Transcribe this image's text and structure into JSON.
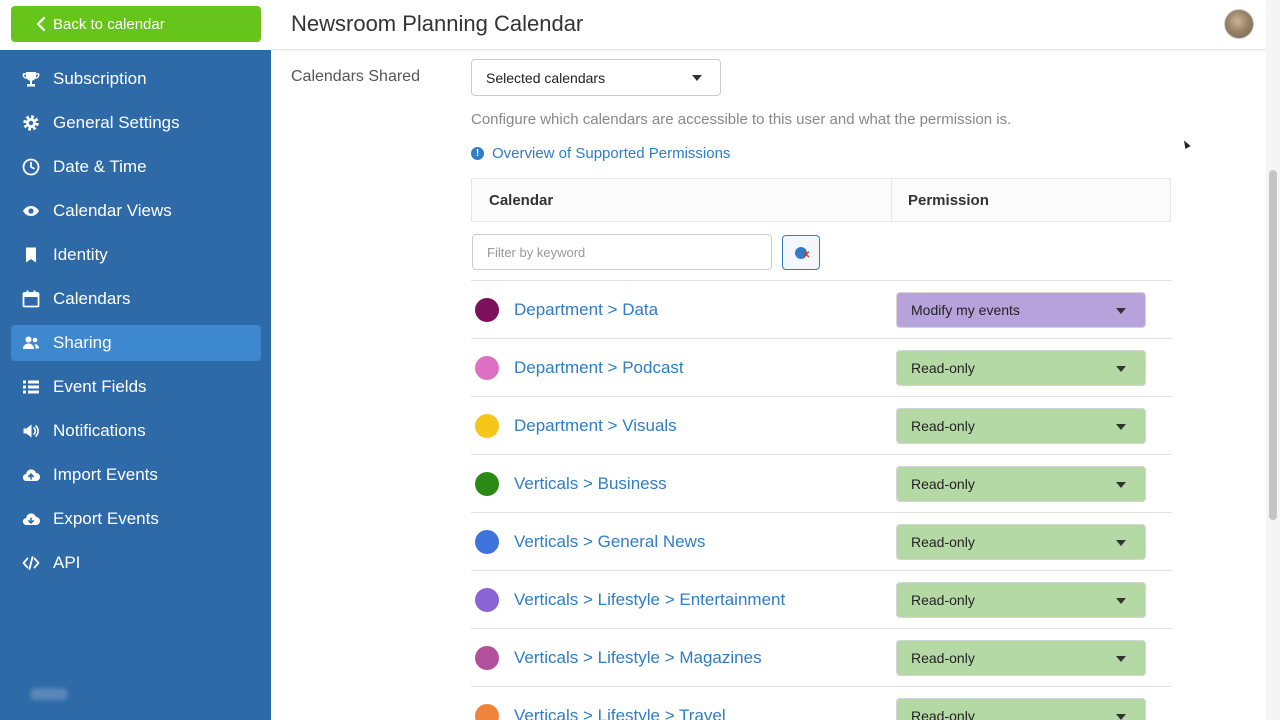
{
  "header": {
    "back_label": "Back to calendar",
    "title": "Newsroom Planning Calendar"
  },
  "sidebar": {
    "items": [
      {
        "label": "Subscription",
        "icon": "trophy-icon",
        "active": false
      },
      {
        "label": "General Settings",
        "icon": "gear-icon",
        "active": false
      },
      {
        "label": "Date & Time",
        "icon": "clock-icon",
        "active": false
      },
      {
        "label": "Calendar Views",
        "icon": "eye-icon",
        "active": false
      },
      {
        "label": "Identity",
        "icon": "bookmark-icon",
        "active": false
      },
      {
        "label": "Calendars",
        "icon": "calendar-icon",
        "active": false
      },
      {
        "label": "Sharing",
        "icon": "users-icon",
        "active": true
      },
      {
        "label": "Event Fields",
        "icon": "list-icon",
        "active": false
      },
      {
        "label": "Notifications",
        "icon": "megaphone-icon",
        "active": false
      },
      {
        "label": "Import Events",
        "icon": "cloud-upload-icon",
        "active": false
      },
      {
        "label": "Export Events",
        "icon": "cloud-download-icon",
        "active": false
      },
      {
        "label": "API",
        "icon": "code-icon",
        "active": false
      }
    ]
  },
  "sharing": {
    "calendars_shared_label": "Calendars Shared",
    "calendars_shared_value": "Selected calendars",
    "description": "Configure which calendars are accessible to this user and what the permission is.",
    "permissions_link": "Overview of Supported Permissions",
    "table": {
      "col_calendar": "Calendar",
      "col_permission": "Permission",
      "filter_placeholder": "Filter by keyword",
      "rows": [
        {
          "name": "Department > Data",
          "color": "#7d0f5c",
          "permission": "Modify my events",
          "perm_bg": "#b7a2dc"
        },
        {
          "name": "Department > Podcast",
          "color": "#dd70c2",
          "permission": "Read-only",
          "perm_bg": "#b5d9a5"
        },
        {
          "name": "Department > Visuals",
          "color": "#f5c518",
          "permission": "Read-only",
          "perm_bg": "#b5d9a5"
        },
        {
          "name": "Verticals > Business",
          "color": "#2a8a14",
          "permission": "Read-only",
          "perm_bg": "#b5d9a5"
        },
        {
          "name": "Verticals > General News",
          "color": "#3f73dc",
          "permission": "Read-only",
          "perm_bg": "#b5d9a5"
        },
        {
          "name": "Verticals > Lifestyle > Entertainment",
          "color": "#8a64d4",
          "permission": "Read-only",
          "perm_bg": "#b5d9a5"
        },
        {
          "name": "Verticals > Lifestyle > Magazines",
          "color": "#b3509e",
          "permission": "Read-only",
          "perm_bg": "#b5d9a5"
        },
        {
          "name": "Verticals > Lifestyle > Travel",
          "color": "#f0843c",
          "permission": "Read-only",
          "perm_bg": "#b5d9a5"
        }
      ]
    }
  }
}
